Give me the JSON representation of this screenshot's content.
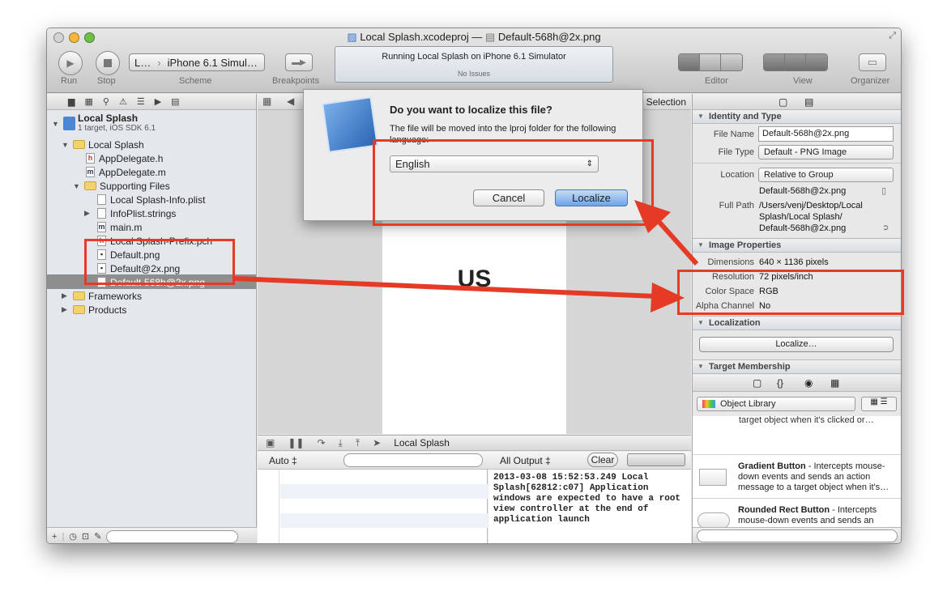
{
  "window": {
    "title": "Local Splash.xcodeproj",
    "title_sep": "—",
    "title_file": "Default-568h@2x.png"
  },
  "toolbar": {
    "run": "Run",
    "stop": "Stop",
    "scheme": "Scheme",
    "breakpoints": "Breakpoints",
    "editor": "Editor",
    "view": "View",
    "organizer": "Organizer",
    "scheme_target": "L…",
    "scheme_device": "iPhone 6.1 Simul…",
    "activity_status": "Running Local Splash on iPhone 6.1 Simulator",
    "activity_issues": "No Issues"
  },
  "navigator": {
    "project": {
      "name": "Local Splash",
      "subtitle": "1 target, iOS SDK 6.1"
    },
    "items": [
      {
        "label": "Local Splash",
        "kind": "folder"
      },
      {
        "label": "AppDelegate.h",
        "kind": "h"
      },
      {
        "label": "AppDelegate.m",
        "kind": "m"
      },
      {
        "label": "Supporting Files",
        "kind": "folder"
      },
      {
        "label": "Local Splash-Info.plist",
        "kind": "plist"
      },
      {
        "label": "InfoPlist.strings",
        "kind": "plist"
      },
      {
        "label": "main.m",
        "kind": "m"
      },
      {
        "label": "Local Splash-Prefix.pch",
        "kind": "h"
      },
      {
        "label": "Default.png",
        "kind": "png"
      },
      {
        "label": "Default@2x.png",
        "kind": "png"
      },
      {
        "label": "Default-568h@2x.png",
        "kind": "png"
      },
      {
        "label": "Frameworks",
        "kind": "folder"
      },
      {
        "label": "Products",
        "kind": "folder"
      }
    ]
  },
  "editor": {
    "jump_selection": "Selection",
    "canvas_text": "US"
  },
  "dialog": {
    "title": "Do you want to localize this file?",
    "message": "The file will be moved into the lproj folder for the following language:",
    "language": "English",
    "cancel": "Cancel",
    "localize": "Localize"
  },
  "debug": {
    "target": "Local Splash",
    "auto": "Auto ‡",
    "output": "All Output ‡",
    "clear": "Clear",
    "console": "2013-03-08 15:52:53.249 Local Splash[62812:c07] Application windows are expected to have a root view controller at the end of application launch"
  },
  "inspector": {
    "identity_header": "Identity and Type",
    "file_name_label": "File Name",
    "file_name": "Default-568h@2x.png",
    "file_type_label": "File Type",
    "file_type": "Default - PNG Image",
    "location_label": "Location",
    "location": "Relative to Group",
    "location_file": "Default-568h@2x.png",
    "full_path_label": "Full Path",
    "full_path_1": "/Users/venj/Desktop/Local",
    "full_path_2": "Splash/Local Splash/",
    "full_path_3": "Default-568h@2x.png",
    "image_header": "Image Properties",
    "dimensions_label": "Dimensions",
    "dimensions": "640 × 1136 pixels",
    "resolution_label": "Resolution",
    "resolution": "72 pixels/inch",
    "color_space_label": "Color Space",
    "color_space": "RGB",
    "alpha_label": "Alpha Channel",
    "alpha": "No",
    "localization_header": "Localization",
    "localize_button": "Localize…",
    "target_header": "Target Membership",
    "library_select": "Object Library",
    "library_partial": "target object when it's clicked or…",
    "library_items": [
      {
        "title": "Gradient Button",
        "desc": " - Intercepts mouse-down events and sends an action message to a target object when it's…"
      },
      {
        "title": "Rounded Rect Button",
        "desc": " - Intercepts mouse-down events and sends an action message to a target object…"
      }
    ]
  },
  "colors": {
    "annotation": "#e53a25",
    "selection": "#8e8e8e"
  }
}
